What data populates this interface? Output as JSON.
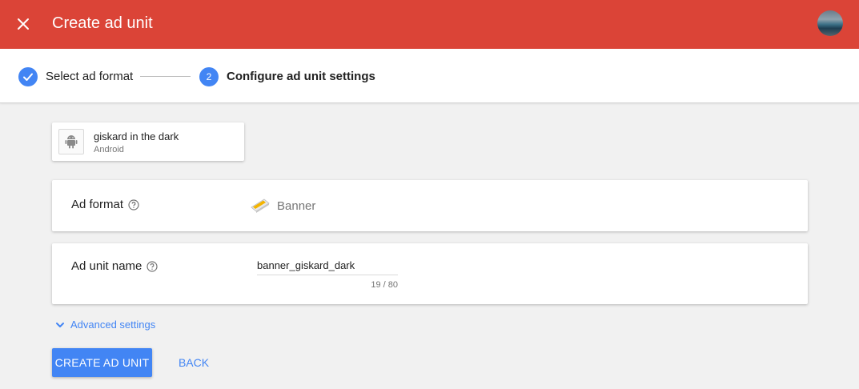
{
  "header": {
    "title": "Create ad unit",
    "close_icon": "close-icon",
    "avatar_icon": "user-avatar"
  },
  "stepper": {
    "steps": [
      {
        "label": "Select ad format",
        "state": "done",
        "icon": "check-icon"
      },
      {
        "label": "Configure ad unit settings",
        "state": "active",
        "number": "2"
      }
    ]
  },
  "app": {
    "name": "giskard in the dark",
    "platform": "Android",
    "icon": "android-icon"
  },
  "ad_format": {
    "label": "Ad format",
    "value": "Banner",
    "icon": "banner-icon",
    "help_icon": "help-icon"
  },
  "ad_unit_name": {
    "label": "Ad unit name",
    "value": "banner_giskard_dark",
    "char_count": "19 / 80",
    "help_icon": "help-icon"
  },
  "advanced": {
    "label": "Advanced settings",
    "icon": "chevron-down-icon"
  },
  "actions": {
    "create_label": "CREATE AD UNIT",
    "back_label": "BACK"
  },
  "colors": {
    "header": "#db4437",
    "accent": "#4285f4",
    "background": "#f1f1f1"
  }
}
